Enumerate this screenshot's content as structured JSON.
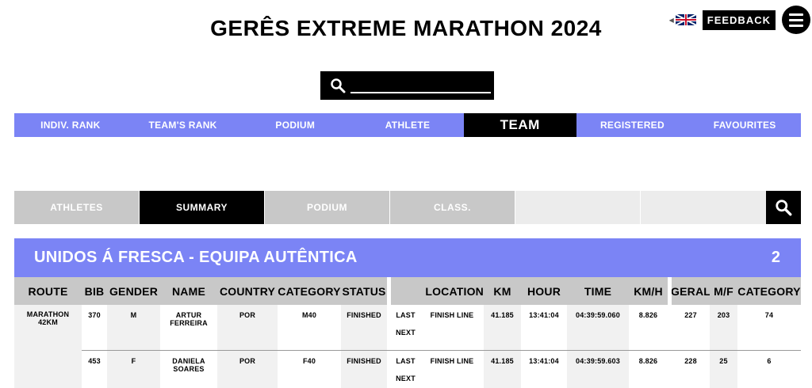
{
  "header": {
    "title": "GERÊS EXTREME MARATHON 2024",
    "feedback_label": "FEEDBACK"
  },
  "search": {
    "placeholder": ""
  },
  "main_nav": [
    {
      "label": "INDIV. RANK",
      "active": false
    },
    {
      "label": "TEAM'S RANK",
      "active": false
    },
    {
      "label": "PODIUM",
      "active": false
    },
    {
      "label": "ATHLETE",
      "active": false
    },
    {
      "label": "TEAM",
      "active": true
    },
    {
      "label": "REGISTERED",
      "active": false
    },
    {
      "label": "FAVOURITES",
      "active": false
    }
  ],
  "sub_nav": [
    {
      "label": "ATHLETES",
      "active": false
    },
    {
      "label": "SUMMARY",
      "active": true
    },
    {
      "label": "PODIUM",
      "active": false
    },
    {
      "label": "CLASS.",
      "active": false
    }
  ],
  "team": {
    "name": "UNIDOS Á FRESCA - EQUIPA AUTÊNTICA",
    "count": "2"
  },
  "columns": [
    "ROUTE",
    "BIB",
    "GENDER",
    "NAME",
    "COUNTRY",
    "CATEGORY",
    "STATUS",
    "LOCATION",
    "KM",
    "HOUR",
    "TIME",
    "KM/H",
    "GERAL",
    "M/F",
    "CATEGORY"
  ],
  "rows": [
    {
      "route_line1": "MARATHON",
      "route_line2": "42KM",
      "bib": "370",
      "gender": "M",
      "name_line1": "ARTUR",
      "name_line2": "FERREIRA",
      "country": "POR",
      "category": "M40",
      "status": "FINISHED",
      "last": "LAST",
      "next": "NEXT",
      "location": "FINISH LINE",
      "km": "41.185",
      "hour": "13:41:04",
      "time": "04:39:59.060",
      "kmh": "8.826",
      "geral": "227",
      "mf": "203",
      "cat_rank": "74"
    },
    {
      "route_line1": "",
      "route_line2": "",
      "bib": "453",
      "gender": "F",
      "name_line1": "DANIELA",
      "name_line2": "SOARES",
      "country": "POR",
      "category": "F40",
      "status": "FINISHED",
      "last": "LAST",
      "next": "NEXT",
      "location": "FINISH LINE",
      "km": "41.185",
      "hour": "13:41:04",
      "time": "04:39:59.603",
      "kmh": "8.826",
      "geral": "228",
      "mf": "25",
      "cat_rank": "6"
    }
  ],
  "colors": {
    "accent": "#7b84f5",
    "grey": "#c8c8c8",
    "light": "#f1f1f1",
    "black": "#000000"
  }
}
